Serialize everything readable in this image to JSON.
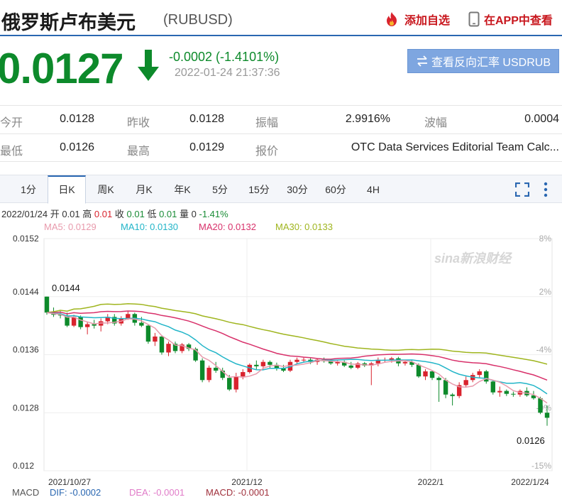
{
  "header": {
    "title": "俄罗斯卢布美元",
    "symbol": "(RUBUSD)",
    "fav_label": "添加自选",
    "app_label": "在APP中查看"
  },
  "quote": {
    "price": "0.0127",
    "direction": "down",
    "change": "-0.0002 (-1.4101%)",
    "timestamp": "2022-01-24 21:37:36",
    "reverse_label": "查看反向汇率 USDRUB"
  },
  "stats": {
    "open_label": "今开",
    "open": "0.0128",
    "prev_close_label": "昨收",
    "prev_close": "0.0128",
    "amplitude_label": "振幅",
    "amplitude": "2.9916%",
    "range_label": "波幅",
    "range": "0.0004",
    "low_label": "最低",
    "low": "0.0126",
    "high_label": "最高",
    "high": "0.0129",
    "quote_label": "报价",
    "quote_source": "OTC Data Services Editorial Team Calc..."
  },
  "tabs": [
    "1分",
    "日K",
    "周K",
    "月K",
    "年K",
    "5分",
    "15分",
    "30分",
    "60分",
    "4H"
  ],
  "active_tab": "日K",
  "ohlc": {
    "date": "2022/01/24",
    "open_label": "开",
    "open": "0.01",
    "high_label": "高",
    "high": "0.01",
    "close_label": "收",
    "close": "0.01",
    "low_label": "低",
    "low": "0.01",
    "volume_label": "量",
    "volume": "0",
    "change": "-1.41%"
  },
  "ma": {
    "ma5": "MA5: 0.0129",
    "ma10": "MA10: 0.0130",
    "ma20": "MA20: 0.0132",
    "ma30": "MA30: 0.0133"
  },
  "colors": {
    "up": "#d9232e",
    "down": "#0d8a2b",
    "ma5": "#e89aac",
    "ma10": "#22b5c8",
    "ma20": "#d8306a",
    "ma30": "#9fb51e",
    "accent": "#2a67b1"
  },
  "watermark": "sina新浪财经",
  "macd": {
    "label": "MACD",
    "dif": "DIF: -0.0002",
    "dea": "DEA: -0.0001",
    "macd": "MACD: -0.0001"
  },
  "chart_data": {
    "type": "candlestick",
    "y_ticks": [
      "0.0152",
      "0.0144",
      "0.0136",
      "0.0128",
      "0.012"
    ],
    "y_right_ticks": [
      "8%",
      "2%",
      "-4%",
      "-9%",
      "-15%"
    ],
    "x_ticks": [
      "2021/10/27",
      "2021/12",
      "2022/1",
      "2022/1/24"
    ],
    "ylim": [
      0.012,
      0.0152
    ],
    "annotations": {
      "max": "0.0144",
      "min": "0.0126"
    },
    "candles": [
      [
        0.0144,
        0.0144,
        0.01415,
        0.01418
      ],
      [
        0.01418,
        0.01425,
        0.01412,
        0.01415
      ],
      [
        0.01415,
        0.0142,
        0.0141,
        0.01414
      ],
      [
        0.01414,
        0.01418,
        0.01398,
        0.014
      ],
      [
        0.014,
        0.01415,
        0.01398,
        0.01412
      ],
      [
        0.01412,
        0.01414,
        0.01395,
        0.01398
      ],
      [
        0.01398,
        0.01405,
        0.01388,
        0.01402
      ],
      [
        0.01402,
        0.01408,
        0.01396,
        0.014
      ],
      [
        0.014,
        0.0141,
        0.01392,
        0.01406
      ],
      [
        0.01406,
        0.01416,
        0.01402,
        0.01412
      ],
      [
        0.01412,
        0.01416,
        0.014,
        0.01403
      ],
      [
        0.01403,
        0.01413,
        0.014,
        0.0141
      ],
      [
        0.0141,
        0.0142,
        0.01408,
        0.01416
      ],
      [
        0.01416,
        0.01418,
        0.014,
        0.01404
      ],
      [
        0.01404,
        0.01412,
        0.01398,
        0.014
      ],
      [
        0.014,
        0.01402,
        0.01375,
        0.01378
      ],
      [
        0.01378,
        0.0139,
        0.01372,
        0.01385
      ],
      [
        0.01385,
        0.01387,
        0.0136,
        0.01363
      ],
      [
        0.01363,
        0.01378,
        0.01358,
        0.01375
      ],
      [
        0.01375,
        0.01378,
        0.01362,
        0.01365
      ],
      [
        0.01365,
        0.01376,
        0.01362,
        0.01374
      ],
      [
        0.01374,
        0.01376,
        0.01365,
        0.01368
      ],
      [
        0.01368,
        0.0137,
        0.0135,
        0.01352
      ],
      [
        0.01352,
        0.01355,
        0.01322,
        0.01325
      ],
      [
        0.01325,
        0.01345,
        0.01322,
        0.01342
      ],
      [
        0.01342,
        0.0135,
        0.01335,
        0.01338
      ],
      [
        0.01338,
        0.01342,
        0.01325,
        0.01328
      ],
      [
        0.01328,
        0.01332,
        0.0131,
        0.01312
      ],
      [
        0.01312,
        0.01335,
        0.01308,
        0.0133
      ],
      [
        0.0133,
        0.0134,
        0.01326,
        0.01336
      ],
      [
        0.01336,
        0.01348,
        0.01334,
        0.01346
      ],
      [
        0.01346,
        0.01352,
        0.0134,
        0.01344
      ],
      [
        0.01344,
        0.01353,
        0.0134,
        0.0135
      ],
      [
        0.0135,
        0.01352,
        0.01342,
        0.01346
      ],
      [
        0.01346,
        0.01349,
        0.01338,
        0.01341
      ],
      [
        0.01341,
        0.01346,
        0.01336,
        0.01338
      ],
      [
        0.01338,
        0.01353,
        0.01336,
        0.0135
      ],
      [
        0.0135,
        0.01356,
        0.01347,
        0.01353
      ],
      [
        0.01353,
        0.01356,
        0.01349,
        0.01353
      ],
      [
        0.01353,
        0.01355,
        0.01347,
        0.0135
      ],
      [
        0.0135,
        0.01355,
        0.01346,
        0.01353
      ],
      [
        0.01353,
        0.01356,
        0.01349,
        0.01351
      ],
      [
        0.01351,
        0.01354,
        0.01346,
        0.01348
      ],
      [
        0.01348,
        0.01352,
        0.01345,
        0.0135
      ],
      [
        0.0135,
        0.01352,
        0.01343,
        0.01345
      ],
      [
        0.01345,
        0.0135,
        0.0134,
        0.01342
      ],
      [
        0.01342,
        0.0135,
        0.0134,
        0.01348
      ],
      [
        0.01348,
        0.0135,
        0.01343,
        0.01345
      ],
      [
        0.01345,
        0.0135,
        0.01318,
        0.01348
      ],
      [
        0.01348,
        0.01356,
        0.01344,
        0.01353
      ],
      [
        0.01353,
        0.01356,
        0.01349,
        0.01353
      ],
      [
        0.01353,
        0.01357,
        0.01349,
        0.01355
      ],
      [
        0.01355,
        0.01357,
        0.01344,
        0.01348
      ],
      [
        0.01348,
        0.01352,
        0.01345,
        0.0135
      ],
      [
        0.0135,
        0.01352,
        0.01343,
        0.01346
      ],
      [
        0.01346,
        0.01348,
        0.01328,
        0.0133
      ],
      [
        0.0133,
        0.0134,
        0.01325,
        0.01337
      ],
      [
        0.01337,
        0.01338,
        0.01325,
        0.01328
      ],
      [
        0.01328,
        0.0133,
        0.01295,
        0.01325
      ],
      [
        0.01325,
        0.01328,
        0.013,
        0.01305
      ],
      [
        0.01305,
        0.01307,
        0.0129,
        0.01303
      ],
      [
        0.01303,
        0.01322,
        0.013,
        0.01318
      ],
      [
        0.01318,
        0.0133,
        0.01315,
        0.01325
      ],
      [
        0.01325,
        0.01335,
        0.01322,
        0.01332
      ],
      [
        0.01332,
        0.0134,
        0.01328,
        0.01337
      ],
      [
        0.01337,
        0.01339,
        0.0132,
        0.01323
      ],
      [
        0.01323,
        0.01325,
        0.01305,
        0.01308
      ],
      [
        0.01308,
        0.01316,
        0.01302,
        0.0131
      ],
      [
        0.0131,
        0.01312,
        0.01303,
        0.01306
      ],
      [
        0.01306,
        0.01309,
        0.01302,
        0.01305
      ],
      [
        0.01305,
        0.01312,
        0.01302,
        0.0131
      ],
      [
        0.0131,
        0.01315,
        0.01302,
        0.01304
      ],
      [
        0.01304,
        0.0131,
        0.01298,
        0.013
      ],
      [
        0.013,
        0.01302,
        0.01278,
        0.0128
      ],
      [
        0.0128,
        0.0129,
        0.01262,
        0.01273
      ]
    ]
  }
}
